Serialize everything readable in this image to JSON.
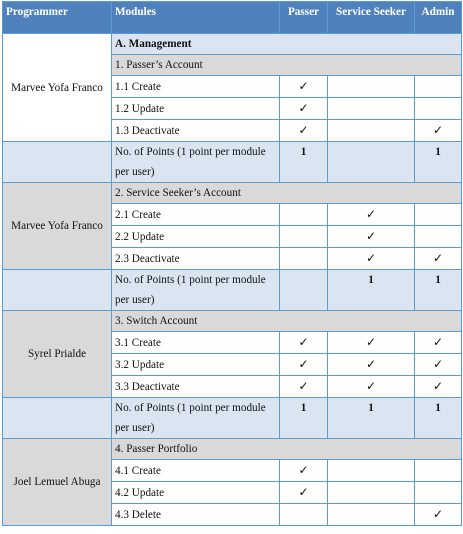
{
  "headers": {
    "programmer": "Programmer",
    "modules": "Modules",
    "passer": "Passer",
    "seeker": "Service Seeker",
    "admin": "Admin"
  },
  "check_glyph": "✓",
  "points_label": "No. of Points (1 point per module per user)",
  "groups": [
    {
      "programmer": "Marvee Yofa Franco",
      "main": "A. Management",
      "section": "1. Passer’s Account",
      "items": [
        {
          "label": "1.1 Create",
          "passer": true,
          "seeker": false,
          "admin": false
        },
        {
          "label": "1.2 Update",
          "passer": true,
          "seeker": false,
          "admin": false
        },
        {
          "label": "1.3 Deactivate",
          "passer": true,
          "seeker": false,
          "admin": true
        }
      ],
      "points": {
        "passer": "1",
        "seeker": "",
        "admin": "1"
      }
    },
    {
      "programmer": "Marvee Yofa Franco",
      "section": "2. Service Seeker’s Account",
      "items": [
        {
          "label": "2.1 Create",
          "passer": false,
          "seeker": true,
          "admin": false
        },
        {
          "label": "2.2 Update",
          "passer": false,
          "seeker": true,
          "admin": false
        },
        {
          "label": "2.3 Deactivate",
          "passer": false,
          "seeker": true,
          "admin": true
        }
      ],
      "points": {
        "passer": "",
        "seeker": "1",
        "admin": "1"
      }
    },
    {
      "programmer": "Syrel Prialde",
      "section": "3. Switch Account",
      "items": [
        {
          "label": "3.1 Create",
          "passer": true,
          "seeker": true,
          "admin": true
        },
        {
          "label": "3.2 Update",
          "passer": true,
          "seeker": true,
          "admin": true
        },
        {
          "label": "3.3 Deactivate",
          "passer": true,
          "seeker": true,
          "admin": true
        }
      ],
      "points": {
        "passer": "1",
        "seeker": "1",
        "admin": "1"
      }
    },
    {
      "programmer": "Joel Lemuel Abuga",
      "section": "4. Passer Portfolio",
      "items": [
        {
          "label": "4.1 Create",
          "passer": true,
          "seeker": false,
          "admin": false
        },
        {
          "label": "4.2 Update",
          "passer": true,
          "seeker": false,
          "admin": false
        },
        {
          "label": "4.3 Delete",
          "passer": false,
          "seeker": false,
          "admin": true
        }
      ]
    }
  ]
}
